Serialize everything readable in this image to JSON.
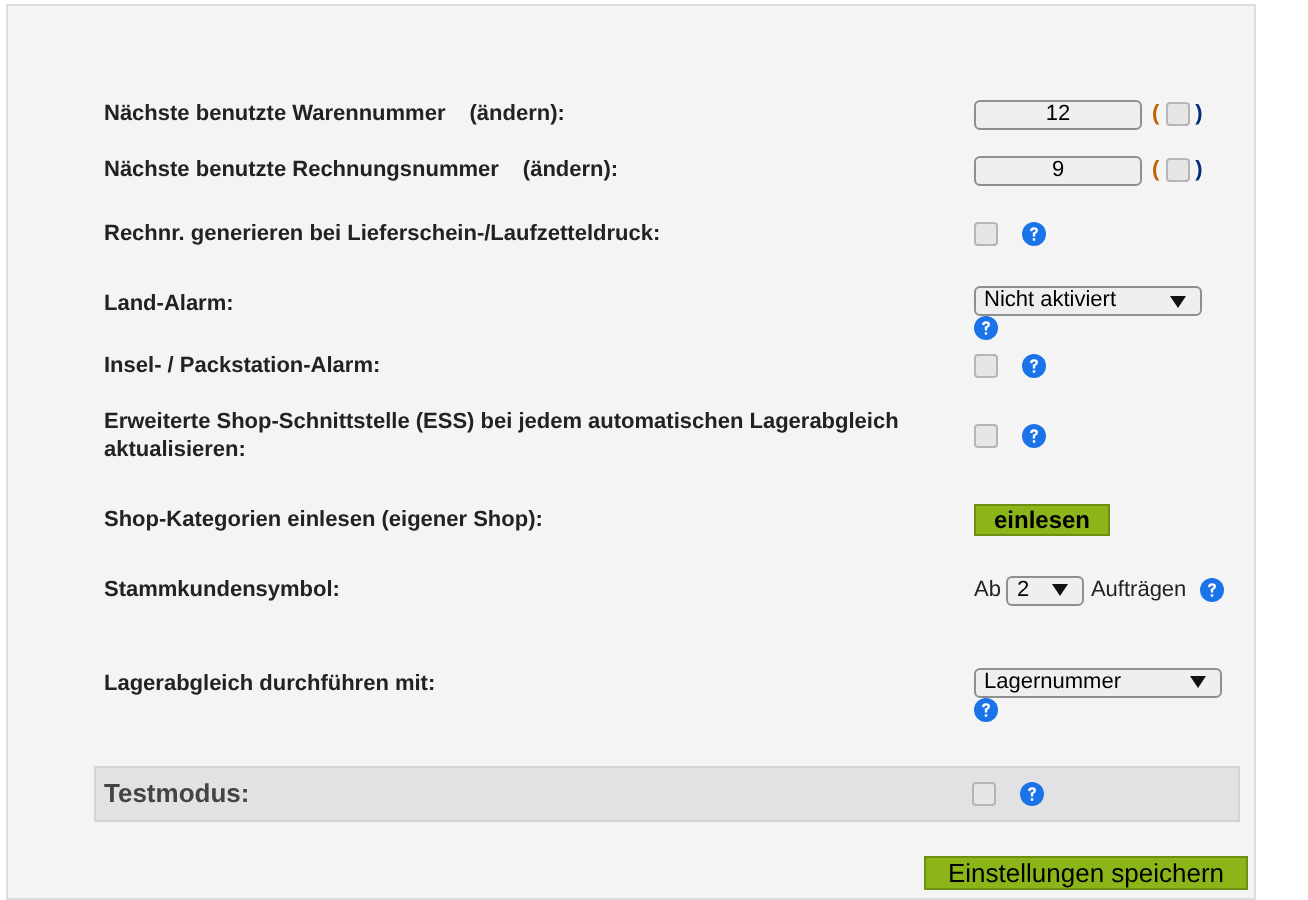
{
  "settings": [
    {
      "kind": "number",
      "label": "Nächste benutzte Warennummer",
      "link": "(ändern):",
      "value": "12",
      "open": "(",
      "close": ")",
      "checked": false
    },
    {
      "kind": "number",
      "label": "Nächste benutzte Rechnungsnummer",
      "link": "(ändern):",
      "value": "9",
      "open": "(",
      "close": ")",
      "checked": false
    },
    {
      "kind": "checkbox",
      "label": "Rechnr. generieren bei Lieferschein-/Laufzetteldruck:",
      "checked": false
    },
    {
      "kind": "select",
      "label": "Land-Alarm:",
      "value": "Nicht aktiviert"
    },
    {
      "kind": "checkbox",
      "label": "Insel- / Packstation-Alarm:",
      "checked": false
    },
    {
      "kind": "checkbox",
      "label": "Erweiterte Shop-Schnittstelle (ESS) bei jedem automatischen Lagerabgleich aktualisieren:",
      "checked": false
    },
    {
      "kind": "button",
      "label": "Shop-Kategorien einlesen (eigener Shop):",
      "button": "einlesen"
    },
    {
      "kind": "inline_select",
      "label": "Stammkundensymbol:",
      "prefix": "Ab",
      "value": "2",
      "suffix": "Aufträgen"
    },
    {
      "kind": "select",
      "label": "Lagerabgleich durchführen mit:",
      "value": "Lagernummer"
    }
  ],
  "test_mode": {
    "label": "Testmodus:",
    "checked": false
  },
  "save_button": "Einstellungen speichern"
}
